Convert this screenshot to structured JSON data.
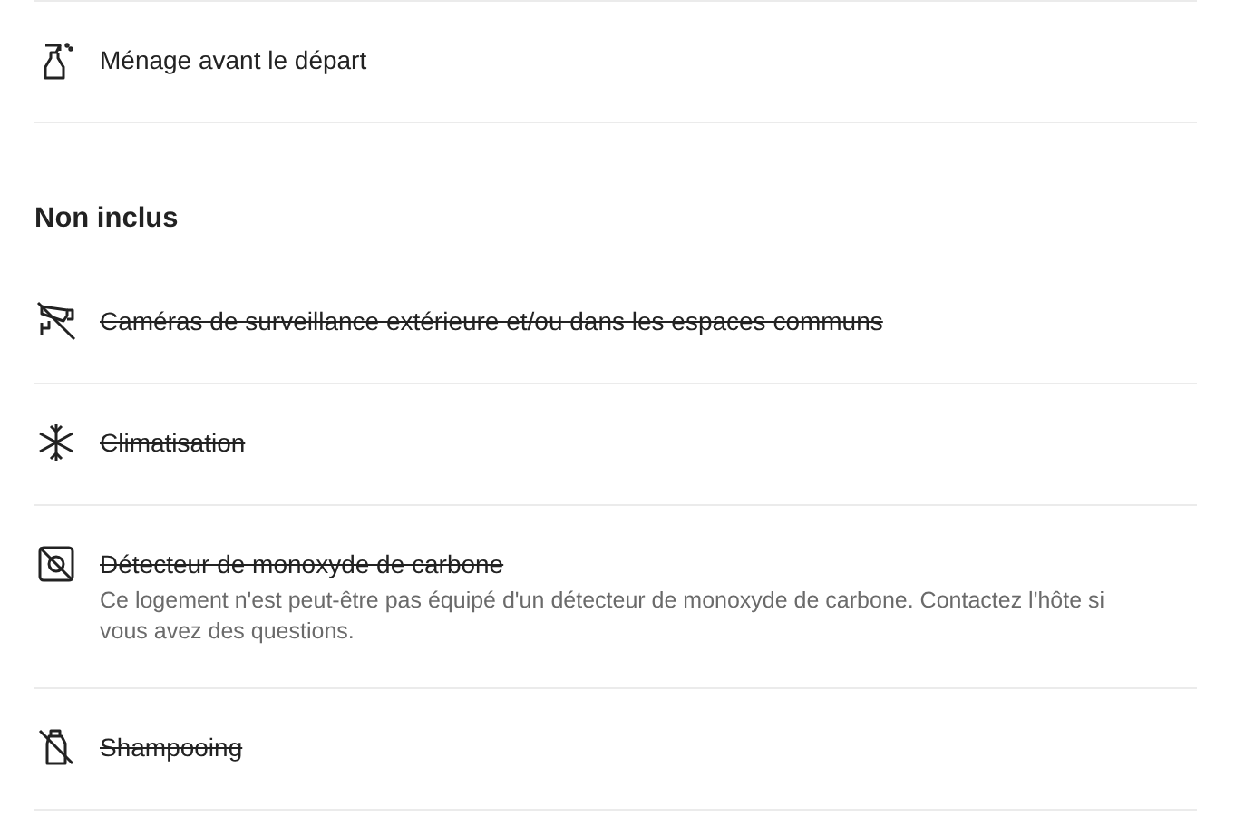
{
  "included": [
    {
      "kind": "spray",
      "label": "Ménage avant le départ",
      "available": true
    }
  ],
  "not_included": {
    "heading": "Non inclus",
    "items": [
      {
        "kind": "camera",
        "label": "Caméras de surveillance extérieure et/ou dans les espaces communs",
        "available": false
      },
      {
        "kind": "snowflake",
        "label": "Climatisation",
        "available": false
      },
      {
        "kind": "detector",
        "label": "Détecteur de monoxyde de carbone",
        "available": false,
        "note": "Ce logement n'est peut-être pas équipé d'un détecteur de monoxyde de carbone. Contactez l'hôte si vous avez des questions."
      },
      {
        "kind": "shampoo",
        "label": "Shampooing",
        "available": false
      }
    ]
  }
}
